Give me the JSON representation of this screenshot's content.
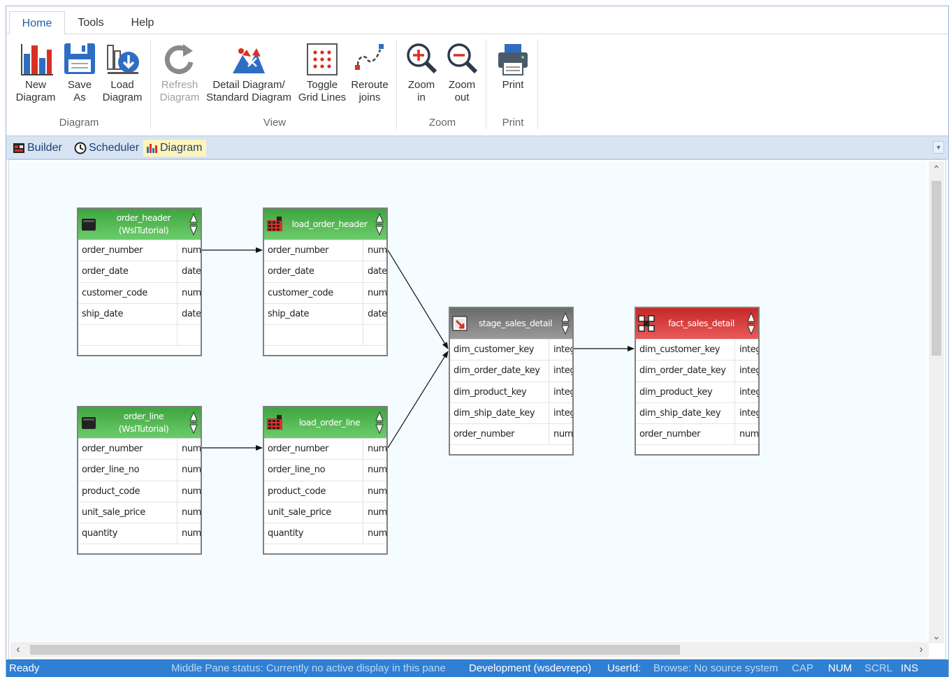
{
  "ribbon": {
    "tabs": [
      "Home",
      "Tools",
      "Help"
    ],
    "buttons": {
      "new_diagram": [
        "New",
        "Diagram"
      ],
      "save_as": [
        "Save",
        "As"
      ],
      "load_diagram": [
        "Load",
        "Diagram"
      ],
      "refresh_diagram": [
        "Refresh",
        "Diagram"
      ],
      "detail_standard": [
        "Detail Diagram/",
        "Standard Diagram"
      ],
      "toggle_grid": [
        "Toggle",
        "Grid Lines"
      ],
      "reroute_joins": [
        "Reroute",
        "joins"
      ],
      "zoom_in": [
        "Zoom",
        "in"
      ],
      "zoom_out": [
        "Zoom",
        "out"
      ],
      "print": [
        "Print"
      ]
    },
    "groups": [
      "Diagram",
      "View",
      "Zoom",
      "Print"
    ]
  },
  "pane_tabs": [
    "Builder",
    "Scheduler",
    "Diagram"
  ],
  "tables": {
    "order_header": {
      "title": [
        "order_header",
        "(WslTutorial)"
      ],
      "rows": [
        [
          "order_number",
          "num"
        ],
        [
          "order_date",
          "date"
        ],
        [
          "customer_code",
          "num"
        ],
        [
          "ship_date",
          "date"
        ],
        [
          "",
          ""
        ]
      ]
    },
    "load_order_header": {
      "title": [
        "load_order_header"
      ],
      "rows": [
        [
          "order_number",
          "num"
        ],
        [
          "order_date",
          "date"
        ],
        [
          "customer_code",
          "num"
        ],
        [
          "ship_date",
          "date"
        ],
        [
          "",
          ""
        ]
      ]
    },
    "order_line": {
      "title": [
        "order_line",
        "(WslTutorial)"
      ],
      "rows": [
        [
          "order_number",
          "num"
        ],
        [
          "order_line_no",
          "num"
        ],
        [
          "product_code",
          "num"
        ],
        [
          "unit_sale_price",
          "num"
        ],
        [
          "quantity",
          "num"
        ]
      ]
    },
    "load_order_line": {
      "title": [
        "load_order_line"
      ],
      "rows": [
        [
          "order_number",
          "num"
        ],
        [
          "order_line_no",
          "num"
        ],
        [
          "product_code",
          "num"
        ],
        [
          "unit_sale_price",
          "num"
        ],
        [
          "quantity",
          "num"
        ]
      ]
    },
    "stage_sales_detail": {
      "title": [
        "stage_sales_detail"
      ],
      "rows": [
        [
          "dim_customer_key",
          "integ"
        ],
        [
          "dim_order_date_key",
          "integ"
        ],
        [
          "dim_product_key",
          "integ"
        ],
        [
          "dim_ship_date_key",
          "integ"
        ],
        [
          "order_number",
          "num"
        ]
      ]
    },
    "fact_sales_detail": {
      "title": [
        "fact_sales_detail"
      ],
      "rows": [
        [
          "dim_customer_key",
          "integ"
        ],
        [
          "dim_order_date_key",
          "integ"
        ],
        [
          "dim_product_key",
          "integ"
        ],
        [
          "dim_ship_date_key",
          "integ"
        ],
        [
          "order_number",
          "num"
        ]
      ]
    }
  },
  "status": {
    "ready": "Ready",
    "middle_pane": "Middle Pane status: Currently no active display in this pane",
    "environment": "Development (wsdevrepo)",
    "userid": "UserId:",
    "browse": "Browse: No source system",
    "cap": "CAP",
    "num": "NUM",
    "scrl": "SCRL",
    "ins": "INS"
  },
  "colors": {
    "source_header": "#3ea53e",
    "load_header": "#3ea53e",
    "stage_header": "#6a6a6a",
    "fact_header": "#c62828",
    "statusbar": "#2f7fd3",
    "canvas": "#f4fcff"
  }
}
